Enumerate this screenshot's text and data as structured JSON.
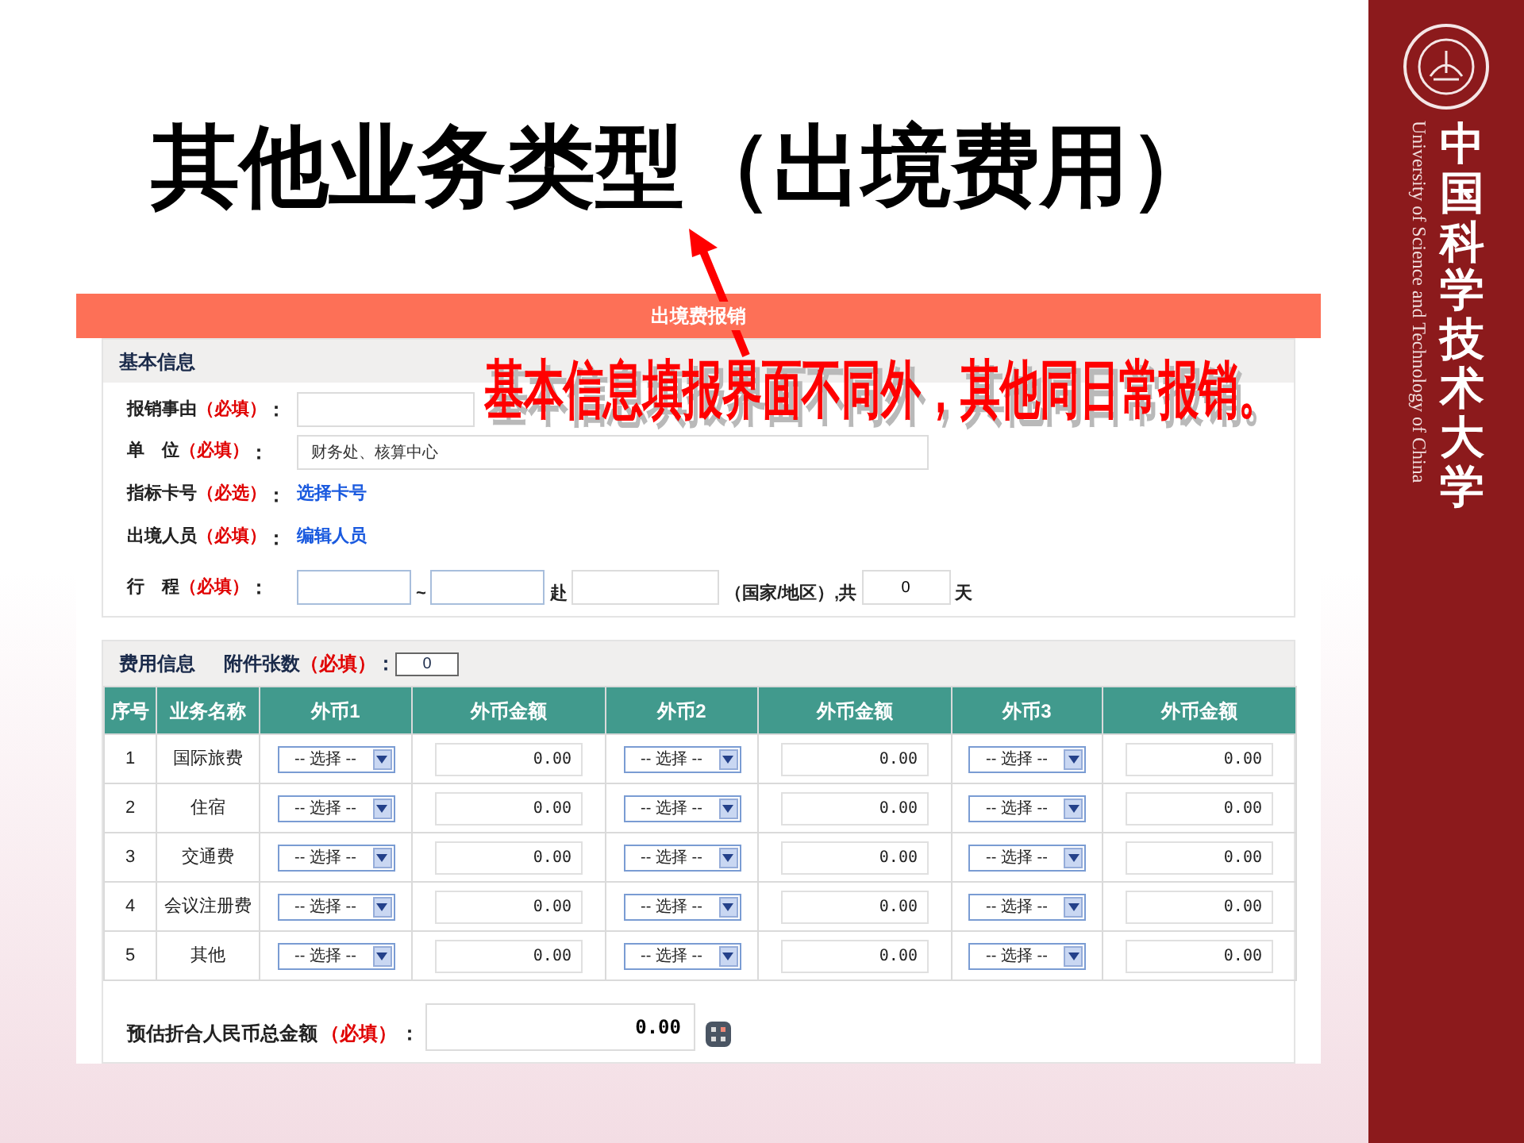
{
  "slide_title": "其他业务类型（出境费用）",
  "annotation": {
    "text": "基本信息填报界面不同外，其他同日常报销。"
  },
  "form": {
    "title": "出境费报销",
    "basic_info": {
      "heading": "基本信息",
      "fields": [
        {
          "kind": "input",
          "label": "报销事由",
          "required": "（必填）",
          "colon": "：",
          "short": true
        },
        {
          "kind": "input",
          "label": "单　位",
          "required": "（必填）",
          "colon": "：",
          "value": "财务处、核算中心"
        },
        {
          "kind": "link",
          "label": "指标卡号",
          "required": "（必选）",
          "colon": "：",
          "link": "选择卡号"
        },
        {
          "kind": "link",
          "label": "出境人员",
          "required": "（必填）",
          "colon": "：",
          "link": "编辑人员"
        },
        {
          "kind": "itinerary",
          "label": "行　程",
          "required": "（必填）",
          "colon": "：",
          "parts": [
            {
              "kind": "date"
            },
            {
              "kind": "text",
              "text": "~"
            },
            {
              "kind": "date"
            },
            {
              "kind": "text",
              "text": "赴"
            },
            {
              "kind": "place"
            },
            {
              "kind": "text",
              "text": "（国家/地区）,共"
            },
            {
              "kind": "days",
              "value": "0"
            },
            {
              "kind": "text",
              "text": "天"
            }
          ]
        }
      ]
    },
    "fee_info": {
      "heading": "费用信息",
      "attachments": {
        "label": "附件张数",
        "required": "（必填）",
        "colon": "：",
        "value": "0"
      },
      "columns": [
        "序号",
        "业务名称",
        "外币1",
        "外币金额",
        "外币2",
        "外币金额",
        "外币3",
        "外币金额"
      ],
      "rows": [
        {
          "no": "1",
          "name": "国际旅费",
          "currencies": [
            {
              "select": "-- 选择 --",
              "amount": "0.00"
            },
            {
              "select": "-- 选择 --",
              "amount": "0.00"
            },
            {
              "select": "-- 选择 --",
              "amount": "0.00"
            }
          ]
        },
        {
          "no": "2",
          "name": "住宿",
          "currencies": [
            {
              "select": "-- 选择 --",
              "amount": "0.00"
            },
            {
              "select": "-- 选择 --",
              "amount": "0.00"
            },
            {
              "select": "-- 选择 --",
              "amount": "0.00"
            }
          ]
        },
        {
          "no": "3",
          "name": "交通费",
          "currencies": [
            {
              "select": "-- 选择 --",
              "amount": "0.00"
            },
            {
              "select": "-- 选择 --",
              "amount": "0.00"
            },
            {
              "select": "-- 选择 --",
              "amount": "0.00"
            }
          ]
        },
        {
          "no": "4",
          "name": "会议注册费",
          "currencies": [
            {
              "select": "-- 选择 --",
              "amount": "0.00"
            },
            {
              "select": "-- 选择 --",
              "amount": "0.00"
            },
            {
              "select": "-- 选择 --",
              "amount": "0.00"
            }
          ]
        },
        {
          "no": "5",
          "name": "其他",
          "currencies": [
            {
              "select": "-- 选择 --",
              "amount": "0.00"
            },
            {
              "select": "-- 选择 --",
              "amount": "0.00"
            },
            {
              "select": "-- 选择 --",
              "amount": "0.00"
            }
          ]
        }
      ],
      "total": {
        "label": "预估折合人民币总金额",
        "required": "（必填）",
        "colon": "：",
        "value": "0.00"
      }
    }
  },
  "sidebar": {
    "name_zh": "中国科学技术大学",
    "name_en": "University of Science and Technology of China"
  }
}
